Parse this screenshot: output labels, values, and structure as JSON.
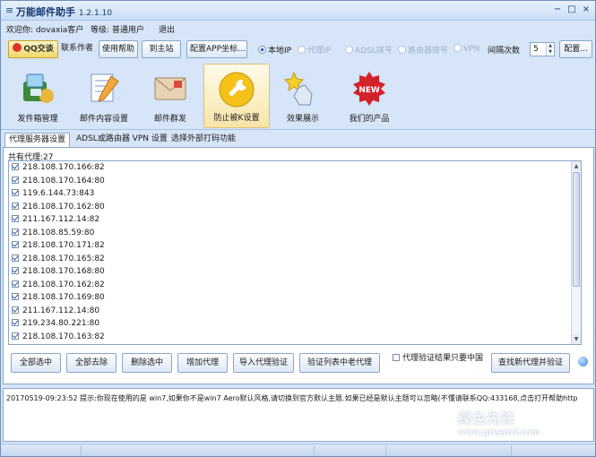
{
  "window": {
    "title": "万能邮件助手",
    "version": "1.2.1.10",
    "minimize_glyph": "−",
    "maximize_glyph": "□",
    "close_glyph": "×"
  },
  "user": {
    "welcome": "欢迎你: dovaxia客户",
    "level": "等级: 普通用户",
    "logout": "退出"
  },
  "toolbar": {
    "qq_chat": "QQ交谈",
    "contact_author": "联系作者",
    "help": "使用帮助",
    "main_site": "到主站",
    "config_app": "配置APP坐标...",
    "local_ip": "本地IP",
    "proxy_ip": "代理IP",
    "adsl": "ADSL拨号",
    "router": "路由器拨号",
    "vpn": "VPN",
    "interval_label": "间隔次数",
    "interval_value": "5",
    "config_btn": "配置..."
  },
  "nav": [
    {
      "label": "发件箱管理"
    },
    {
      "label": "邮件内容设置"
    },
    {
      "label": "邮件群发"
    },
    {
      "label": "防止被K设置"
    },
    {
      "label": "效果展示"
    },
    {
      "label": "我们的产品"
    }
  ],
  "tabs": [
    "代理服务器设置",
    "ADSL或路由器 VPN 设置",
    "选择外部打码功能"
  ],
  "proxies": {
    "count_label": "共有代理:27",
    "items": [
      "218.108.170.166:82",
      "218.108.170.164:80",
      "119.6.144.73:843",
      "218.108.170.162:80",
      "211.167.112.14:82",
      "218.108.85.59:80",
      "218.108.170.171:82",
      "218.108.170.165:82",
      "218.108.170.168:80",
      "218.108.170.162:82",
      "218.108.170.169:80",
      "211.167.112.14:80",
      "219.234.80.221:80",
      "218.108.170.163:82"
    ]
  },
  "actions": {
    "select_all": "全部选中",
    "remove_all": "全部去除",
    "delete_selected": "删除选中",
    "add_proxy": "增加代理",
    "import_verify": "导入代理验证",
    "verify_list": "验证列表中老代理",
    "only_china": "代理验证结果只要中国",
    "find_new": "查找新代理并验证"
  },
  "log": {
    "line": "20170519-09:23:52  提示:你现在使用的是 win7,如果你不是win7 Aero默认风格,请切换到官方默认主题.如果已经是默认主题可以忽略(不懂请联系QQ:433168,点击打开帮助http"
  },
  "watermark": {
    "name": "绿色先锋",
    "url": "www.greenxf.com"
  }
}
